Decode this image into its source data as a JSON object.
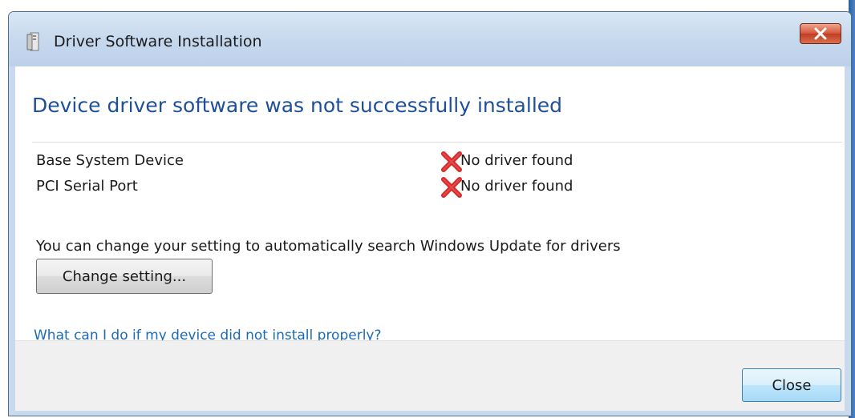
{
  "window": {
    "title": "Driver Software Installation",
    "close_icon": "close-icon"
  },
  "main": {
    "heading": "Device driver software was not successfully installed",
    "devices": [
      {
        "name": "Base System Device",
        "status": "No driver found",
        "status_icon": "error-x-icon"
      },
      {
        "name": "PCI Serial Port",
        "status": "No driver found",
        "status_icon": "error-x-icon"
      }
    ],
    "info_text": "You can change your setting to automatically search Windows Update for drivers",
    "change_button": "Change setting...",
    "help_link": "What can I do if my device did not install properly?"
  },
  "footer": {
    "close_button": "Close"
  },
  "colors": {
    "heading": "#1f4f99",
    "link": "#1b6ab5",
    "error_red": "#d62a2a",
    "frame": "#c9daee"
  }
}
